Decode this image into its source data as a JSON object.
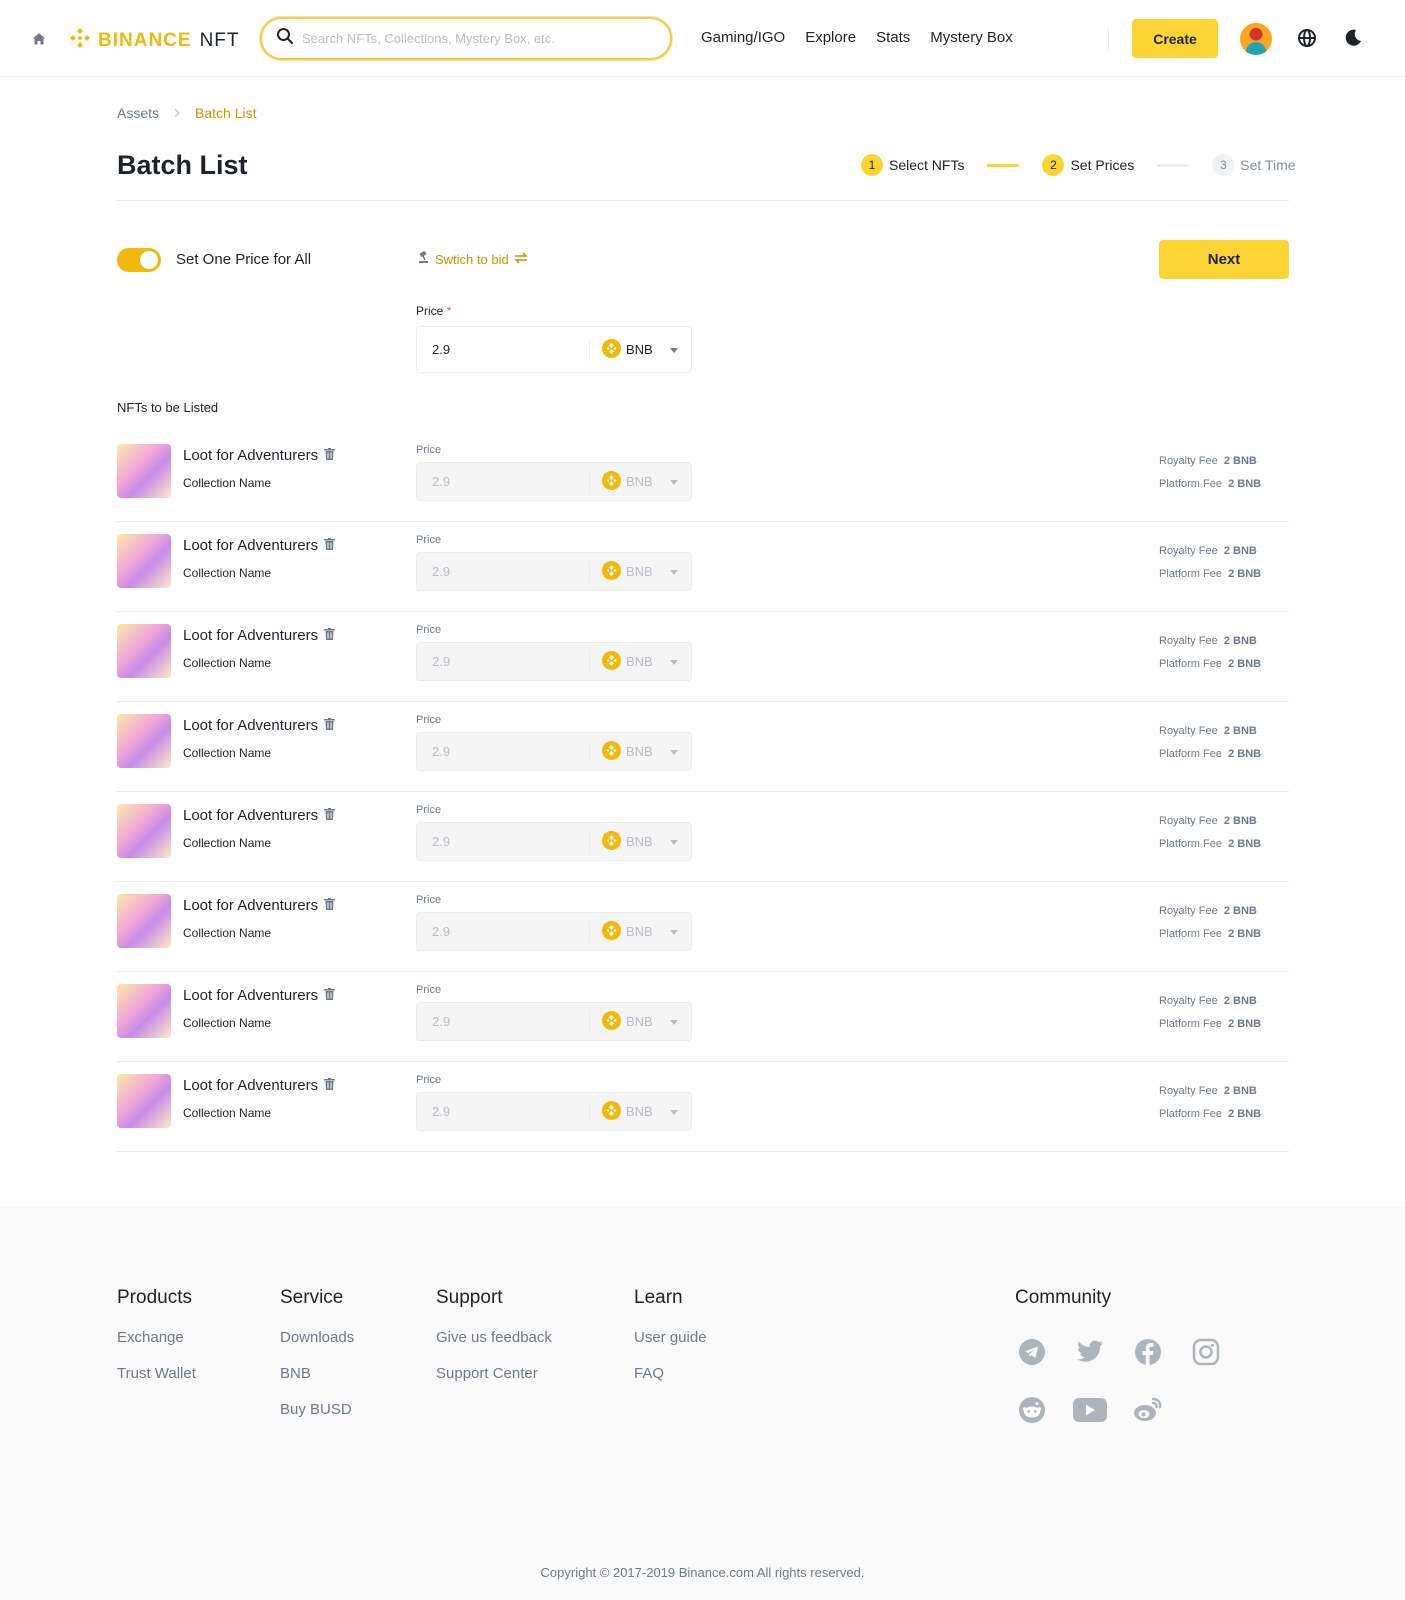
{
  "header": {
    "logo_brand": "BINANCE",
    "logo_suffix": "NFT",
    "search_placeholder": "Search NFTs, Collections, Mystery Box, etc.",
    "nav": [
      "Gaming/IGO",
      "Explore",
      "Stats",
      "Mystery Box"
    ],
    "create_label": "Create"
  },
  "breadcrumb": [
    "Assets",
    "Batch List"
  ],
  "page_title": "Batch List",
  "steps": [
    {
      "num": "1",
      "label": "Select NFTs"
    },
    {
      "num": "2",
      "label": "Set Prices"
    },
    {
      "num": "3",
      "label": "Set Time"
    }
  ],
  "controls": {
    "toggle_label": "Set One Price for All",
    "switch_bid": "Swtich to bid",
    "next_label": "Next",
    "price_label": "Price",
    "price_value": "2.9",
    "currency": "BNB"
  },
  "list_title": "NFTs to be Listed",
  "nfts": [
    {
      "name": "Loot for Adventurers",
      "collection": "Collection Name",
      "price_label": "Price",
      "price": "2.9",
      "currency": "BNB",
      "royalty_label": "Royalty Fee",
      "royalty": "2 BNB",
      "platform_label": "Platform Fee",
      "platform": "2 BNB"
    },
    {
      "name": "Loot for Adventurers",
      "collection": "Collection Name",
      "price_label": "Price",
      "price": "2.9",
      "currency": "BNB",
      "royalty_label": "Royalty Fee",
      "royalty": "2 BNB",
      "platform_label": "Platform Fee",
      "platform": "2 BNB"
    },
    {
      "name": "Loot for Adventurers",
      "collection": "Collection Name",
      "price_label": "Price",
      "price": "2.9",
      "currency": "BNB",
      "royalty_label": "Royalty Fee",
      "royalty": "2 BNB",
      "platform_label": "Platform Fee",
      "platform": "2 BNB"
    },
    {
      "name": "Loot for Adventurers",
      "collection": "Collection Name",
      "price_label": "Price",
      "price": "2.9",
      "currency": "BNB",
      "royalty_label": "Royalty Fee",
      "royalty": "2 BNB",
      "platform_label": "Platform Fee",
      "platform": "2 BNB"
    },
    {
      "name": "Loot for Adventurers",
      "collection": "Collection Name",
      "price_label": "Price",
      "price": "2.9",
      "currency": "BNB",
      "royalty_label": "Royalty Fee",
      "royalty": "2 BNB",
      "platform_label": "Platform Fee",
      "platform": "2 BNB"
    },
    {
      "name": "Loot for Adventurers",
      "collection": "Collection Name",
      "price_label": "Price",
      "price": "2.9",
      "currency": "BNB",
      "royalty_label": "Royalty Fee",
      "royalty": "2 BNB",
      "platform_label": "Platform Fee",
      "platform": "2 BNB"
    },
    {
      "name": "Loot for Adventurers",
      "collection": "Collection Name",
      "price_label": "Price",
      "price": "2.9",
      "currency": "BNB",
      "royalty_label": "Royalty Fee",
      "royalty": "2 BNB",
      "platform_label": "Platform Fee",
      "platform": "2 BNB"
    },
    {
      "name": "Loot for Adventurers",
      "collection": "Collection Name",
      "price_label": "Price",
      "price": "2.9",
      "currency": "BNB",
      "royalty_label": "Royalty Fee",
      "royalty": "2 BNB",
      "platform_label": "Platform Fee",
      "platform": "2 BNB"
    }
  ],
  "footer": {
    "columns": [
      {
        "title": "Products",
        "links": [
          "Exchange",
          "Trust Wallet"
        ]
      },
      {
        "title": "Service",
        "links": [
          "Downloads",
          "BNB",
          "Buy BUSD"
        ]
      },
      {
        "title": "Support",
        "links": [
          "Give us feedback",
          "Support Center"
        ]
      },
      {
        "title": "Learn",
        "links": [
          "User guide",
          "FAQ"
        ]
      }
    ],
    "community_title": "Community",
    "social_icons": [
      "telegram-icon",
      "twitter-icon",
      "facebook-icon",
      "instagram-icon",
      "reddit-icon",
      "youtube-icon",
      "weibo-icon"
    ],
    "copyright": "Copyright © 2017-2019 Binance.com All rights reserved."
  },
  "colors": {
    "accent": "#fcd535",
    "brand": "#f0b90b",
    "link_gold": "#c99400"
  }
}
